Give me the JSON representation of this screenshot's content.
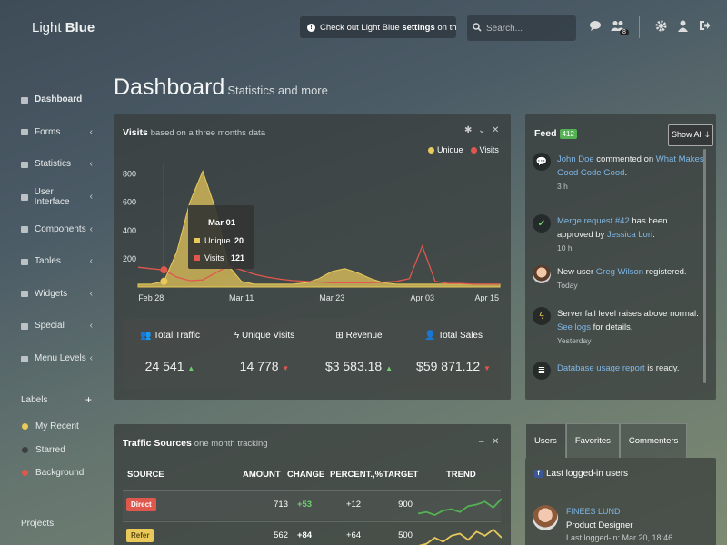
{
  "header": {
    "logo_light": "Light",
    "logo_bold": "Blue",
    "notice_pre": "Check out Light Blue ",
    "notice_bold": "settings",
    "notice_post": " on the right!",
    "search_placeholder": "Search...",
    "notifications_count": "8"
  },
  "sidebar": {
    "items": [
      {
        "label": "Dashboard",
        "icon": "home-icon"
      },
      {
        "label": "Forms",
        "icon": "pencil-icon"
      },
      {
        "label": "Statistics",
        "icon": "chart-icon"
      },
      {
        "label": "User Interface",
        "icon": "magic-icon"
      },
      {
        "label": "Components",
        "icon": "puzzle-icon"
      },
      {
        "label": "Tables",
        "icon": "cog-icon"
      },
      {
        "label": "Widgets",
        "icon": "grid-icon"
      },
      {
        "label": "Special",
        "icon": "leaf-icon"
      },
      {
        "label": "Menu Levels",
        "icon": "folder-icon"
      }
    ],
    "labels_title": "Labels",
    "labels": [
      {
        "name": "My Recent",
        "color": "#e8c95a"
      },
      {
        "name": "Starred",
        "color": "#3c3f40"
      },
      {
        "name": "Background",
        "color": "#e0574d"
      }
    ],
    "projects": "Projects"
  },
  "page": {
    "title": "Dashboard",
    "subtitle": "Statistics and more"
  },
  "visits": {
    "title": "Visits",
    "subtitle": "based on a three months data",
    "legend": [
      {
        "name": "Unique",
        "color": "#e8c95a"
      },
      {
        "name": "Visits",
        "color": "#e0574d"
      }
    ],
    "tooltip": {
      "date": "Mar 01",
      "unique_label": "Unique",
      "unique": "20",
      "visits_label": "Visits",
      "visits": "121"
    },
    "stats": [
      {
        "label": "Total Traffic",
        "value": "24 541",
        "trend": "up",
        "icon": "users-icon"
      },
      {
        "label": "Unique Visits",
        "value": "14 778",
        "trend": "down",
        "icon": "bolt-icon"
      },
      {
        "label": "Revenue",
        "value": "$3 583.18",
        "trend": "up",
        "icon": "plus-square-icon"
      },
      {
        "label": "Total Sales",
        "value": "$59 871.12",
        "trend": "down",
        "icon": "user-icon"
      }
    ]
  },
  "chart_data": {
    "type": "area",
    "title": "Visits",
    "xlabel": "",
    "ylabel": "",
    "x_ticks": [
      "Feb 28",
      "Mar 11",
      "Mar 23",
      "Apr 03",
      "Apr 15"
    ],
    "y_ticks": [
      "800",
      "600",
      "400",
      "200"
    ],
    "ylim": [
      0,
      900
    ],
    "x": [
      0,
      2,
      4,
      6,
      8,
      10,
      12,
      14,
      16,
      18,
      20,
      22,
      24,
      26,
      28,
      30,
      32,
      34,
      36,
      38,
      40,
      42,
      44,
      46,
      48,
      50,
      52,
      54,
      56
    ],
    "series": [
      {
        "name": "Unique",
        "color": "#e8c95a",
        "values": [
          20,
          20,
          40,
          250,
          600,
          820,
          550,
          150,
          40,
          20,
          20,
          20,
          20,
          30,
          60,
          110,
          130,
          100,
          60,
          30,
          20,
          20,
          20,
          20,
          20,
          20,
          20,
          20,
          20
        ]
      },
      {
        "name": "Visits",
        "color": "#e0574d",
        "values": [
          140,
          130,
          121,
          70,
          45,
          50,
          100,
          150,
          120,
          90,
          70,
          55,
          45,
          40,
          35,
          30,
          30,
          30,
          30,
          35,
          40,
          60,
          290,
          40,
          25,
          25,
          20,
          20,
          20
        ]
      }
    ]
  },
  "feed": {
    "title": "Feed",
    "count": "412",
    "show_all": "Show All",
    "items": [
      {
        "icon": "comment-icon",
        "pre": "",
        "link1": "John Doe",
        "mid": " commented on ",
        "link2": "What Makes Good Code Good",
        "post": ".",
        "time": "3 h"
      },
      {
        "icon": "check-icon",
        "pre": "",
        "link1": "Merge request #42",
        "mid": " has been approved by ",
        "link2": "Jessica Lori",
        "post": ".",
        "time": "10 h"
      },
      {
        "icon": "avatar-icon",
        "pre": "New user ",
        "link1": "Greg Wilson",
        "mid": " registered.",
        "link2": "",
        "post": "",
        "time": "Today"
      },
      {
        "icon": "bolt-icon",
        "pre": "Server fail level raises above normal. ",
        "link1": "See logs",
        "mid": " for details.",
        "link2": "",
        "post": "",
        "time": "Yesterday"
      },
      {
        "icon": "database-icon",
        "pre": "",
        "link1": "Database usage report",
        "mid": " is ready.",
        "link2": "",
        "post": "",
        "time": ""
      }
    ]
  },
  "traffic": {
    "title": "Traffic Sources",
    "subtitle": "one month tracking",
    "columns": [
      "SOURCE",
      "AMOUNT",
      "CHANGE",
      "PERCENT.,%",
      "TARGET",
      "TREND"
    ],
    "rows": [
      {
        "source": "Direct",
        "color": "#e0574d",
        "amount": "713",
        "change": "+53",
        "percent": "+12",
        "target": "900",
        "trend": [
          6,
          7,
          5,
          8,
          9,
          7,
          11,
          12,
          14,
          10,
          16
        ]
      },
      {
        "source": "Refer",
        "color": "#e8c95a",
        "amount": "562",
        "change": "+84",
        "percent": "+64",
        "target": "500",
        "trend": [
          5,
          6,
          9,
          7,
          10,
          11,
          8,
          12,
          10,
          13,
          9
        ]
      }
    ]
  },
  "users": {
    "tabs": [
      "Users",
      "Favorites",
      "Commenters"
    ],
    "last_logged": "Last logged-in users",
    "name": "FINEES LUND",
    "role": "Product Designer",
    "last_login": "Last logged-in: Mar 20, 18:46"
  }
}
